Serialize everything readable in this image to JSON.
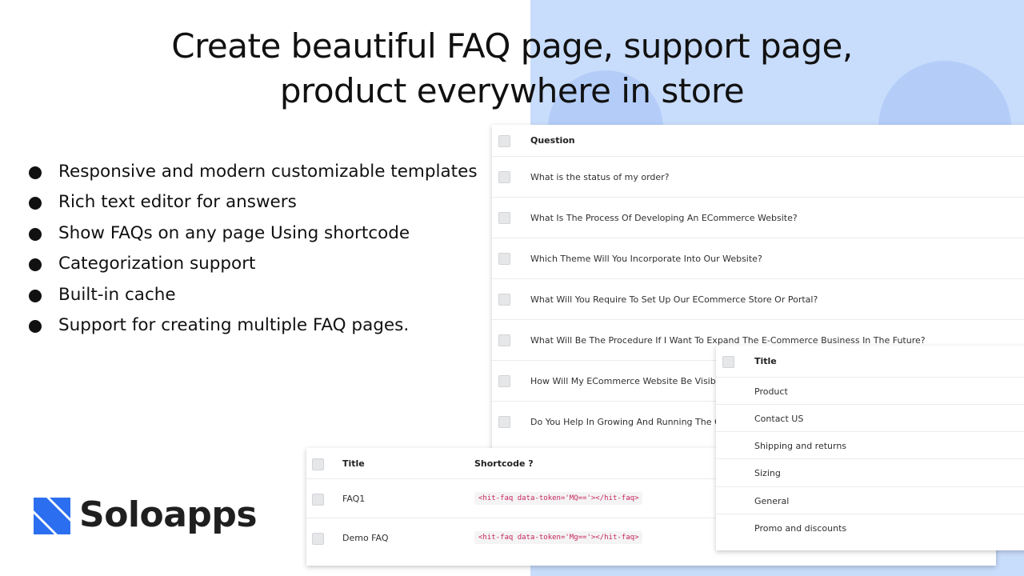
{
  "headline": {
    "line1": "Create beautiful FAQ page, support page,",
    "line2": "product everywhere in store"
  },
  "features": [
    "Responsive and modern customizable templates",
    "Rich text editor for answers",
    "Show FAQs on any page Using shortcode",
    "Categorization support",
    "Built-in cache",
    "Support for creating multiple FAQ pages."
  ],
  "questions_table": {
    "header": "Question",
    "rows": [
      "What is the status of my order?",
      "What Is The Process Of Developing An ECommerce Website?",
      "Which Theme Will You Incorporate Into Our Website?",
      "What Will You Require To Set Up Our ECommerce Store Or Portal?",
      "What Will Be The Procedure If I Want To Expand The E-Commerce Business In The Future?",
      "How Will My ECommerce Website Be Visible To",
      "Do You Help In Growing And Running The Onli"
    ]
  },
  "faq_table": {
    "header_title": "Title",
    "header_shortcode": "Shortcode",
    "help_icon": "?",
    "rows": [
      {
        "title": "FAQ1",
        "shortcode": "<hit-faq data-token='MQ=='></hit-faq>"
      },
      {
        "title": "Demo FAQ",
        "shortcode": "<hit-faq data-token='Mg=='></hit-faq>"
      }
    ]
  },
  "categories_table": {
    "header": "Title",
    "rows": [
      "Product",
      "Contact US",
      "Shipping and returns",
      "Sizing",
      "General",
      "Promo and discounts"
    ]
  },
  "brand": {
    "name": "Soloapps",
    "logo_icon": "soloapps-logo-icon",
    "logo_color": "#2b6ff0"
  },
  "colors": {
    "right_panel": "#c8dcfc",
    "shortcode_text": "#c6265e"
  }
}
